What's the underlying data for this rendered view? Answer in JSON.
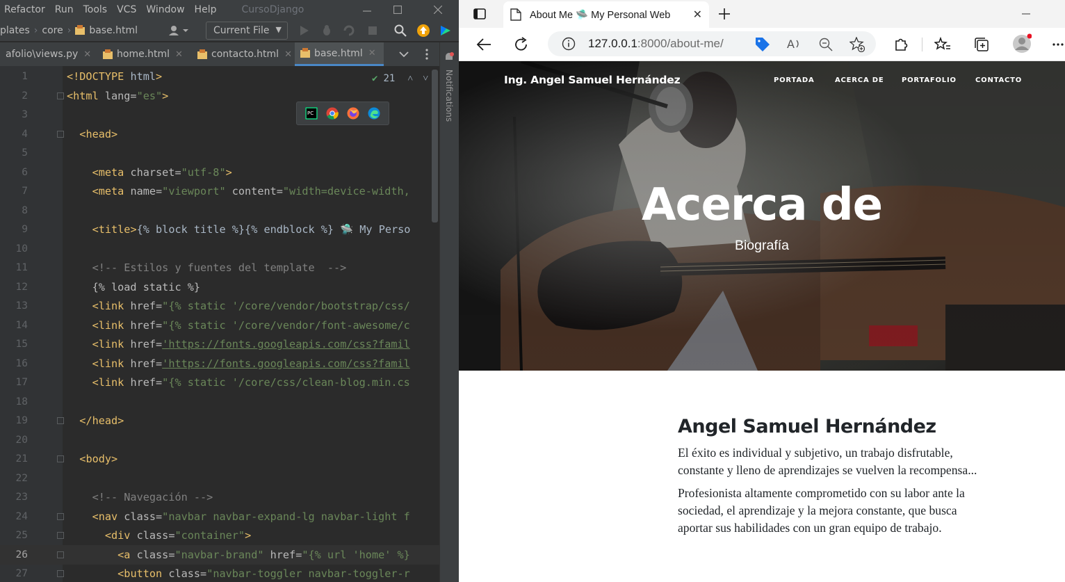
{
  "ide": {
    "menu": [
      "Refactor",
      "Run",
      "Tools",
      "VCS",
      "Window",
      "Help"
    ],
    "project_name": "CursoDjango",
    "breadcrumb": [
      "plates",
      "core",
      "base.html"
    ],
    "run_config": "Current File",
    "tabs": [
      {
        "label": "afolio\\views.py"
      },
      {
        "label": "home.html"
      },
      {
        "label": "contacto.html"
      },
      {
        "label": "base.html",
        "active": true
      }
    ],
    "notifications_label": "Notifications",
    "inspection_count": "21",
    "code_lines": [
      {
        "n": "1",
        "text": "<!DOCTYPE html>"
      },
      {
        "n": "2",
        "text": "<html lang=\"es\">"
      },
      {
        "n": "3",
        "text": ""
      },
      {
        "n": "4",
        "text": "  <head>"
      },
      {
        "n": "5",
        "text": ""
      },
      {
        "n": "6",
        "text": "    <meta charset=\"utf-8\">"
      },
      {
        "n": "7",
        "text": "    <meta name=\"viewport\" content=\"width=device-width,"
      },
      {
        "n": "8",
        "text": ""
      },
      {
        "n": "9",
        "text": "    <title>{% block title %}{% endblock %} 🛸 My Perso"
      },
      {
        "n": "10",
        "text": ""
      },
      {
        "n": "11",
        "text": "    <!-- Estilos y fuentes del template  -->"
      },
      {
        "n": "12",
        "text": "    {% load static %}"
      },
      {
        "n": "13",
        "text": "    <link href=\"{% static '/core/vendor/bootstrap/css/"
      },
      {
        "n": "14",
        "text": "    <link href=\"{% static '/core/vendor/font-awesome/c"
      },
      {
        "n": "15",
        "text": "    <link href='https://fonts.googleapis.com/css?famil"
      },
      {
        "n": "16",
        "text": "    <link href='https://fonts.googleapis.com/css?famil"
      },
      {
        "n": "17",
        "text": "    <link href=\"{% static '/core/css/clean-blog.min.cs"
      },
      {
        "n": "18",
        "text": ""
      },
      {
        "n": "19",
        "text": "  </head>"
      },
      {
        "n": "20",
        "text": ""
      },
      {
        "n": "21",
        "text": "  <body>"
      },
      {
        "n": "22",
        "text": ""
      },
      {
        "n": "23",
        "text": "    <!-- Navegación -->"
      },
      {
        "n": "24",
        "text": "    <nav class=\"navbar navbar-expand-lg navbar-light f"
      },
      {
        "n": "25",
        "text": "      <div class=\"container\">"
      },
      {
        "n": "26",
        "text": "        <a class=\"navbar-brand\" href=\"{% url 'home' %}"
      },
      {
        "n": "27",
        "text": "        <button class=\"navbar-toggler navbar-toggler-r"
      }
    ],
    "current_line": "26"
  },
  "browser": {
    "tab_title": "About Me 🛸 My Personal Web",
    "url_host": "127.0.0.1",
    "url_rest": ":8000/about-me/"
  },
  "site": {
    "brand": "Ing. Angel Samuel Hernández",
    "nav": [
      "PORTADA",
      "ACERCA DE",
      "PORTAFOLIO",
      "CONTACTO"
    ],
    "hero_title": "Acerca de",
    "hero_subtitle": "Biografía",
    "about_name": "Angel Samuel Hernández",
    "paragraphs": [
      "El éxito es individual y subjetivo, un trabajo disfrutable, constante y lleno de aprendizajes se vuelven la recompensa...",
      "Profesionista altamente comprometido con su labor ante la sociedad, el aprendizaje y la mejora constante, que busca aportar sus habilidades con un gran equipo de trabajo."
    ]
  },
  "colors": {
    "ide_bg": "#2b2b2b",
    "ide_panel": "#3c3f41",
    "accent_tab": "#4a88c7",
    "tag": "#e8bf6a",
    "string": "#6a8759"
  }
}
